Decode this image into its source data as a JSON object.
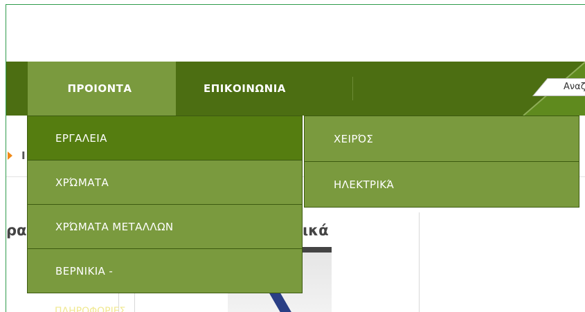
{
  "nav": {
    "items": [
      {
        "label": "ΠΡΟΙΟΝΤΑ"
      },
      {
        "label": "ΕΠΙΚΟΙΝΩΝΙΑ"
      }
    ],
    "search_placeholder": "Αναζ"
  },
  "breadcrumb": {
    "fragment": "Ι"
  },
  "content": {
    "heading_left": "ρα",
    "heading_right": "ικά",
    "faded_label": "ΠΛΗΡΟΦΟΡΙΕΣ"
  },
  "dropdown": {
    "items": [
      {
        "label": "ΕΡΓΑΛΕΙΑ"
      },
      {
        "label": "ΧΡΏΜΑΤΑ"
      },
      {
        "label": "ΧΡΏΜΑΤΑ ΜΕΤΑΛΛΩΝ"
      },
      {
        "label": "ΒΕΡΝΙΚΙΑ -"
      }
    ]
  },
  "submenu": {
    "items": [
      {
        "label": "ΧΕΙΡΌΣ"
      },
      {
        "label": "ΗΛΕΚΤΡΙΚΆ"
      }
    ]
  },
  "colors": {
    "nav_bg": "#4c6e12",
    "nav_active": "#7a9a3e",
    "menu_bg": "#7a9a3e",
    "menu_highlight": "#557d10",
    "accent_arrow": "#f08a18"
  }
}
